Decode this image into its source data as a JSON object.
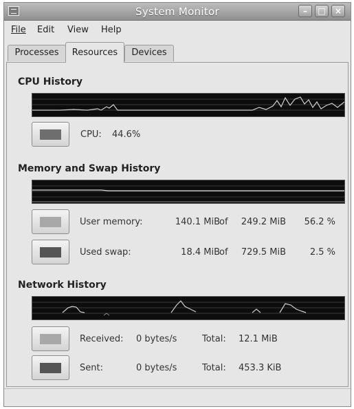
{
  "window": {
    "title": "System Monitor"
  },
  "menu": {
    "file": "File",
    "edit": "Edit",
    "view": "View",
    "help": "Help"
  },
  "tabs": [
    "Processes",
    "Resources",
    "Devices"
  ],
  "cpu": {
    "section_title": "CPU History",
    "label": "CPU:",
    "value": "44.6%",
    "color": "#6e6e6e"
  },
  "memory": {
    "section_title": "Memory and Swap History",
    "user": {
      "label": "User memory:",
      "used": "140.1 MiB",
      "of": "of",
      "total": "249.2 MiB",
      "percent": "56.2 %",
      "color": "#a8a8a8"
    },
    "swap": {
      "label": "Used swap:",
      "used": "18.4 MiB",
      "of": "of",
      "total": "729.5 MiB",
      "percent": "2.5 %",
      "color": "#555555"
    }
  },
  "network": {
    "section_title": "Network History",
    "received": {
      "label": "Received:",
      "rate": "0 bytes/s",
      "total_label": "Total:",
      "total": "12.1 MiB",
      "color": "#a8a8a8"
    },
    "sent": {
      "label": "Sent:",
      "rate": "0 bytes/s",
      "total_label": "Total:",
      "total": "453.3 KiB",
      "color": "#555555"
    }
  },
  "colors": {
    "graph_bg": "#0d0d0d",
    "graph_grid": "#3a3a3a",
    "graph_line": "#cfcfcf"
  }
}
